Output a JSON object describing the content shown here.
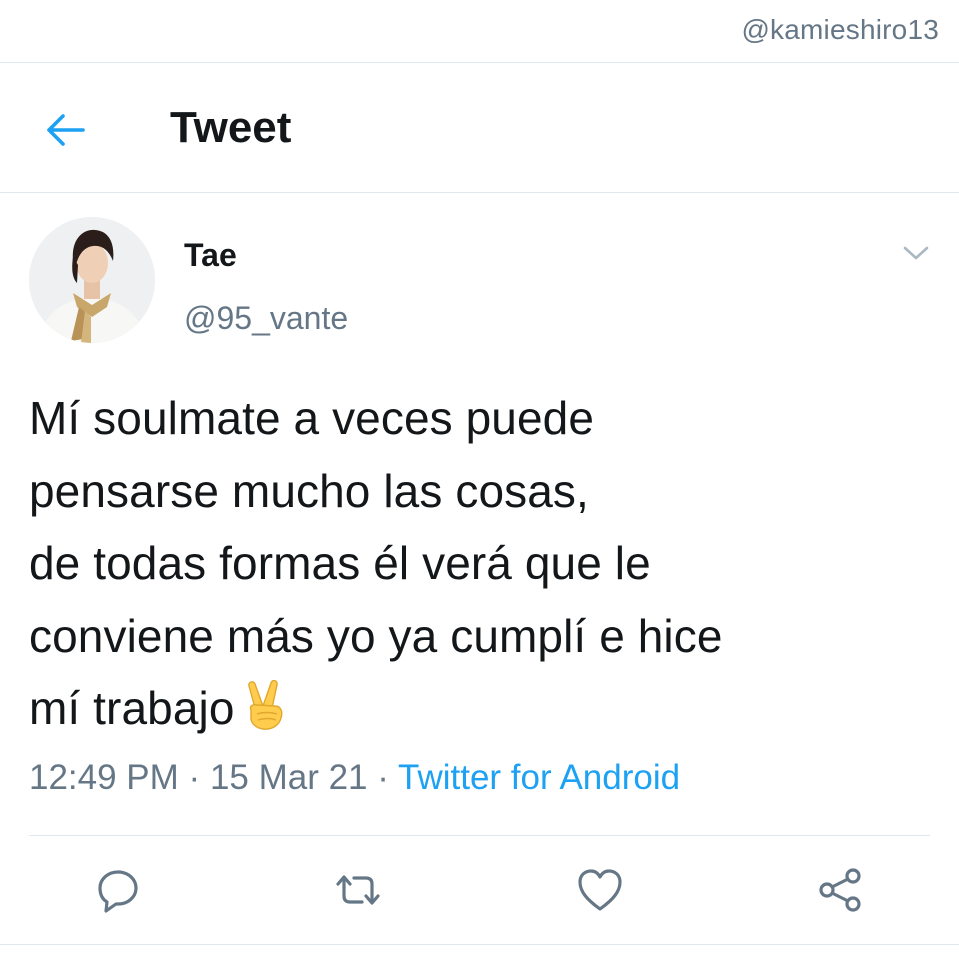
{
  "watermark": "@kamieshiro13",
  "header": {
    "title": "Tweet",
    "back_icon": "arrow-left-icon"
  },
  "tweet": {
    "author_name": "Tae",
    "author_handle": "@95_vante",
    "text_lines": [
      "Mí soulmate a veces puede",
      "pensarse mucho las cosas,",
      "de todas formas él verá que le",
      "conviene más yo ya cumplí e hice",
      "mí trabajo"
    ],
    "emoji": "victory-hand-emoji",
    "time": "12:49 PM",
    "separator": "·",
    "date": "15 Mar 21",
    "source": "Twitter for Android"
  },
  "actions": {
    "reply_icon": "reply-icon",
    "retweet_icon": "retweet-icon",
    "like_icon": "heart-icon",
    "share_icon": "share-icon"
  },
  "colors": {
    "accent": "#1da1f2",
    "text": "#14171a",
    "muted": "#657786",
    "divider": "#e1e8ed"
  }
}
